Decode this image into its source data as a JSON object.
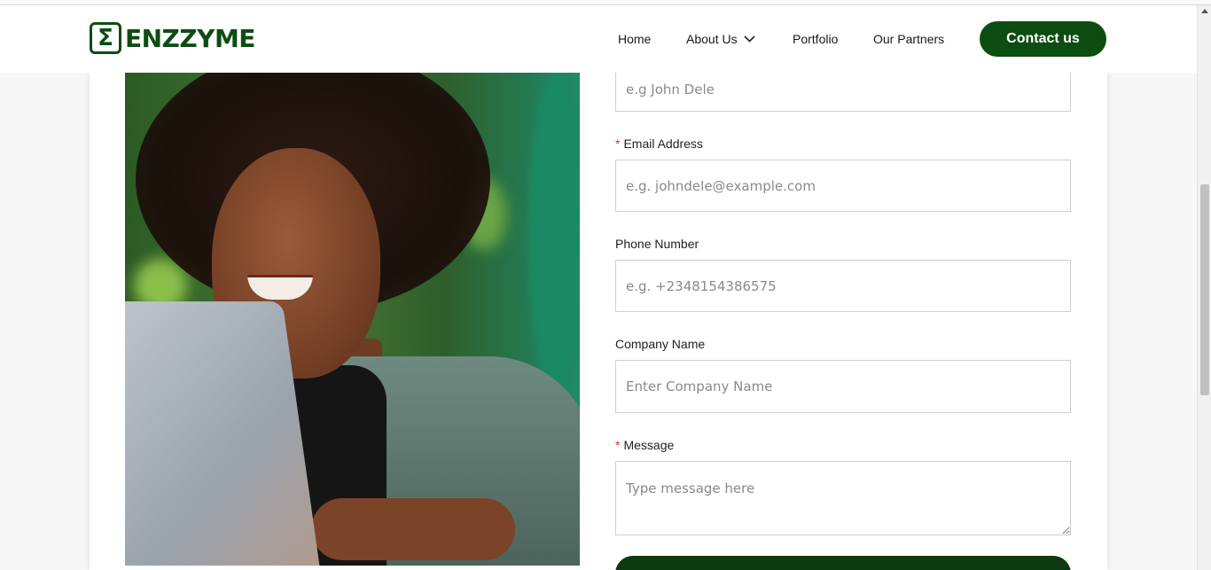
{
  "brand": {
    "logo_mark": "Σ",
    "name": "ENZZYME",
    "color": "#0c4d12"
  },
  "nav": {
    "home": "Home",
    "about": "About Us",
    "portfolio": "Portfolio",
    "partners": "Our Partners",
    "contact": "Contact us"
  },
  "form": {
    "name_placeholder": "e.g John Dele",
    "email_label": "Email Address",
    "email_placeholder": "e.g. johndele@example.com",
    "phone_label": "Phone Number",
    "phone_placeholder": "e.g. +2348154386575",
    "company_label": "Company Name",
    "company_placeholder": "Enter Company Name",
    "message_label": "Message",
    "message_placeholder": "Type message here",
    "required_mark": "*"
  },
  "icons": {
    "dropdown": "chevron-down-icon",
    "scroll_up": "arrow-up-icon"
  }
}
